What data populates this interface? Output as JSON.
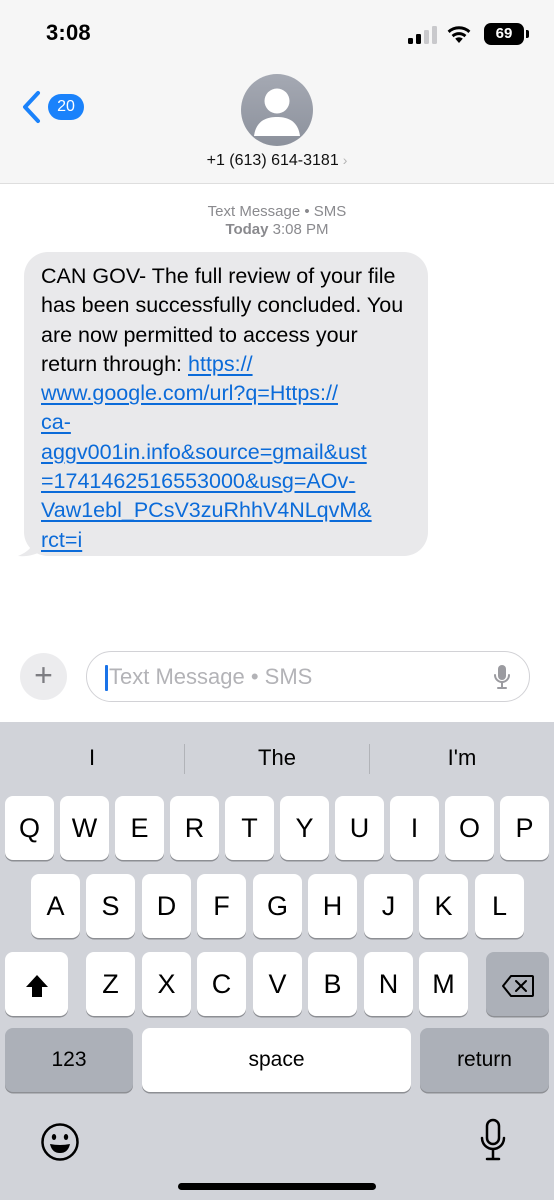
{
  "status_bar": {
    "time": "3:08",
    "battery_level": "69",
    "signal_icon": "cellular-signal-icon",
    "wifi_icon": "wifi-icon"
  },
  "header": {
    "back_badge_count": "20",
    "contact_name": "+1 (613) 614-3181",
    "contact_chevron": "›",
    "avatar_icon": "person-silhouette-icon"
  },
  "conversation": {
    "service_label": "Text Message • SMS",
    "timestamp_day": "Today",
    "timestamp_time": "3:08 PM",
    "message": {
      "text_lines": [
        "CAN GOV- The full review of your file",
        "has been successfully concluded. You",
        "are now permitted to access your",
        "return through: "
      ],
      "link_lines": [
        "https://",
        "www.google.com/url?q=Https://",
        "ca-",
        "aggv001in.info&source=gmail&ust",
        "=1741462516553000&usg=AOv-",
        "Vaw1ebl_PCsV3zuRhhV4NLqvM&",
        "rct=i"
      ]
    }
  },
  "input_bar": {
    "plus_label": "+",
    "placeholder": "Text Message • SMS"
  },
  "keyboard": {
    "predictions": [
      "I",
      "The",
      "I'm"
    ],
    "row1": [
      "Q",
      "W",
      "E",
      "R",
      "T",
      "Y",
      "U",
      "I",
      "O",
      "P"
    ],
    "row2": [
      "A",
      "S",
      "D",
      "F",
      "G",
      "H",
      "J",
      "K",
      "L"
    ],
    "row3": [
      "Z",
      "X",
      "C",
      "V",
      "B",
      "N",
      "M"
    ],
    "numbers_label": "123",
    "space_label": "space",
    "return_label": "return"
  }
}
